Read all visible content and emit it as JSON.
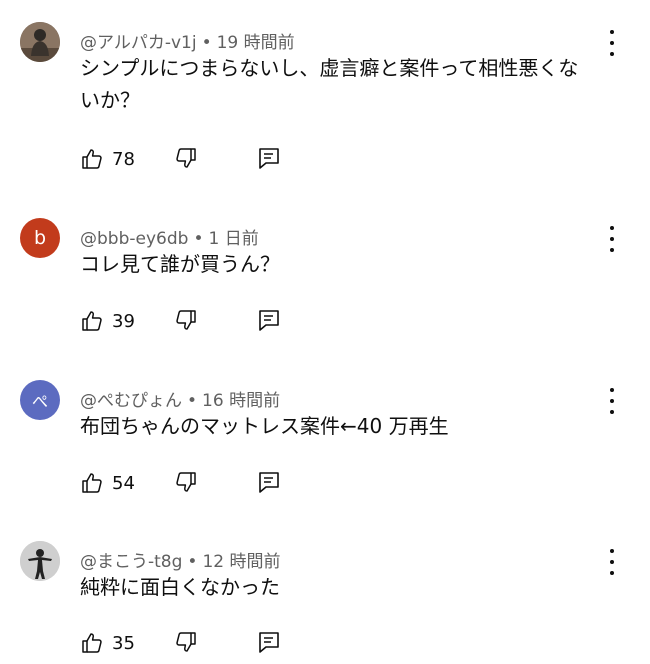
{
  "comments": [
    {
      "author": "@アルパカ-v1j",
      "time": "19 時間前",
      "text": "シンプルにつまらないし、虚言癖と案件って相性悪くないか？",
      "likes": "78",
      "avatar": {
        "type": "photo",
        "bg": "#6b5a4a",
        "icon": "person-photo-icon"
      }
    },
    {
      "author": "@bbb-ey6db",
      "time": "1 日前",
      "text": "コレ見て誰が買うん？",
      "likes": "39",
      "avatar": {
        "type": "letter",
        "letter": "b",
        "bg": "#c23b1c"
      }
    },
    {
      "author": "@ぺむぴょん",
      "time": "16 時間前",
      "text": "布団ちゃんのマットレス案件←40 万再生",
      "likes": "54",
      "avatar": {
        "type": "letter",
        "letter": "ぺ",
        "bg": "#5c6bc0"
      }
    },
    {
      "author": "@まこう-t8g",
      "time": "12 時間前",
      "text": "純粋に面白くなかった",
      "likes": "35",
      "avatar": {
        "type": "photo",
        "bg": "#c8c8c8",
        "icon": "person-photo-icon"
      }
    }
  ]
}
